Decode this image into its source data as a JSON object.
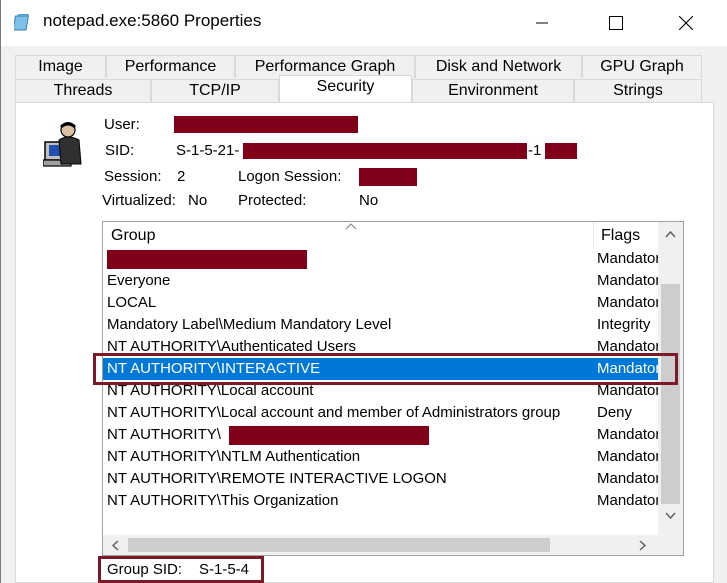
{
  "window": {
    "title": "notepad.exe:5860 Properties"
  },
  "tabs": {
    "row1": [
      {
        "label": "Image"
      },
      {
        "label": "Performance"
      },
      {
        "label": "Performance Graph"
      },
      {
        "label": "Disk and Network"
      },
      {
        "label": "GPU Graph"
      }
    ],
    "row2": [
      {
        "label": "Threads"
      },
      {
        "label": "TCP/IP"
      },
      {
        "label": "Security",
        "active": true
      },
      {
        "label": "Environment"
      },
      {
        "label": "Strings"
      }
    ]
  },
  "info": {
    "user_label": "User:",
    "sid_label": "SID:",
    "sid_prefix": "S-1-5-21-",
    "sid_mid": "-1",
    "session_label": "Session:",
    "session_value": "2",
    "logon_session_label": "Logon Session:",
    "virtualized_label": "Virtualized:",
    "virtualized_value": "No",
    "protected_label": "Protected:",
    "protected_value": "No"
  },
  "groups": {
    "columns": {
      "group": "Group",
      "flags": "Flags"
    },
    "rows": [
      {
        "group": "",
        "flags": "Mandatory"
      },
      {
        "group": "Everyone",
        "flags": "Mandatory"
      },
      {
        "group": "LOCAL",
        "flags": "Mandatory"
      },
      {
        "group": "Mandatory Label\\Medium Mandatory Level",
        "flags": "Integrity"
      },
      {
        "group": "NT AUTHORITY\\Authenticated Users",
        "flags": "Mandatory"
      },
      {
        "group": "NT AUTHORITY\\INTERACTIVE",
        "flags": "Mandatory"
      },
      {
        "group": "NT AUTHORITY\\Local account",
        "flags": "Mandatory"
      },
      {
        "group": "NT AUTHORITY\\Local account and member of Administrators group",
        "flags": "Deny"
      },
      {
        "group": "NT AUTHORITY\\",
        "flags": "Mandatory"
      },
      {
        "group": "NT AUTHORITY\\NTLM Authentication",
        "flags": "Mandatory"
      },
      {
        "group": "NT AUTHORITY\\REMOTE INTERACTIVE LOGON",
        "flags": "Mandatory"
      },
      {
        "group": "NT AUTHORITY\\This Organization",
        "flags": "Mandatory"
      }
    ],
    "selected_index": 5
  },
  "footer": {
    "group_sid_label": "Group SID:",
    "group_sid_value": "S-1-5-4"
  },
  "colors": {
    "selection": "#0078d7",
    "redaction": "#800019",
    "highlight_box": "#7b1a26"
  },
  "icons": {
    "app": "notepad-icon",
    "user": "user-computer-icon",
    "minimize": "minimize-icon",
    "maximize": "maximize-icon",
    "close": "close-icon"
  }
}
